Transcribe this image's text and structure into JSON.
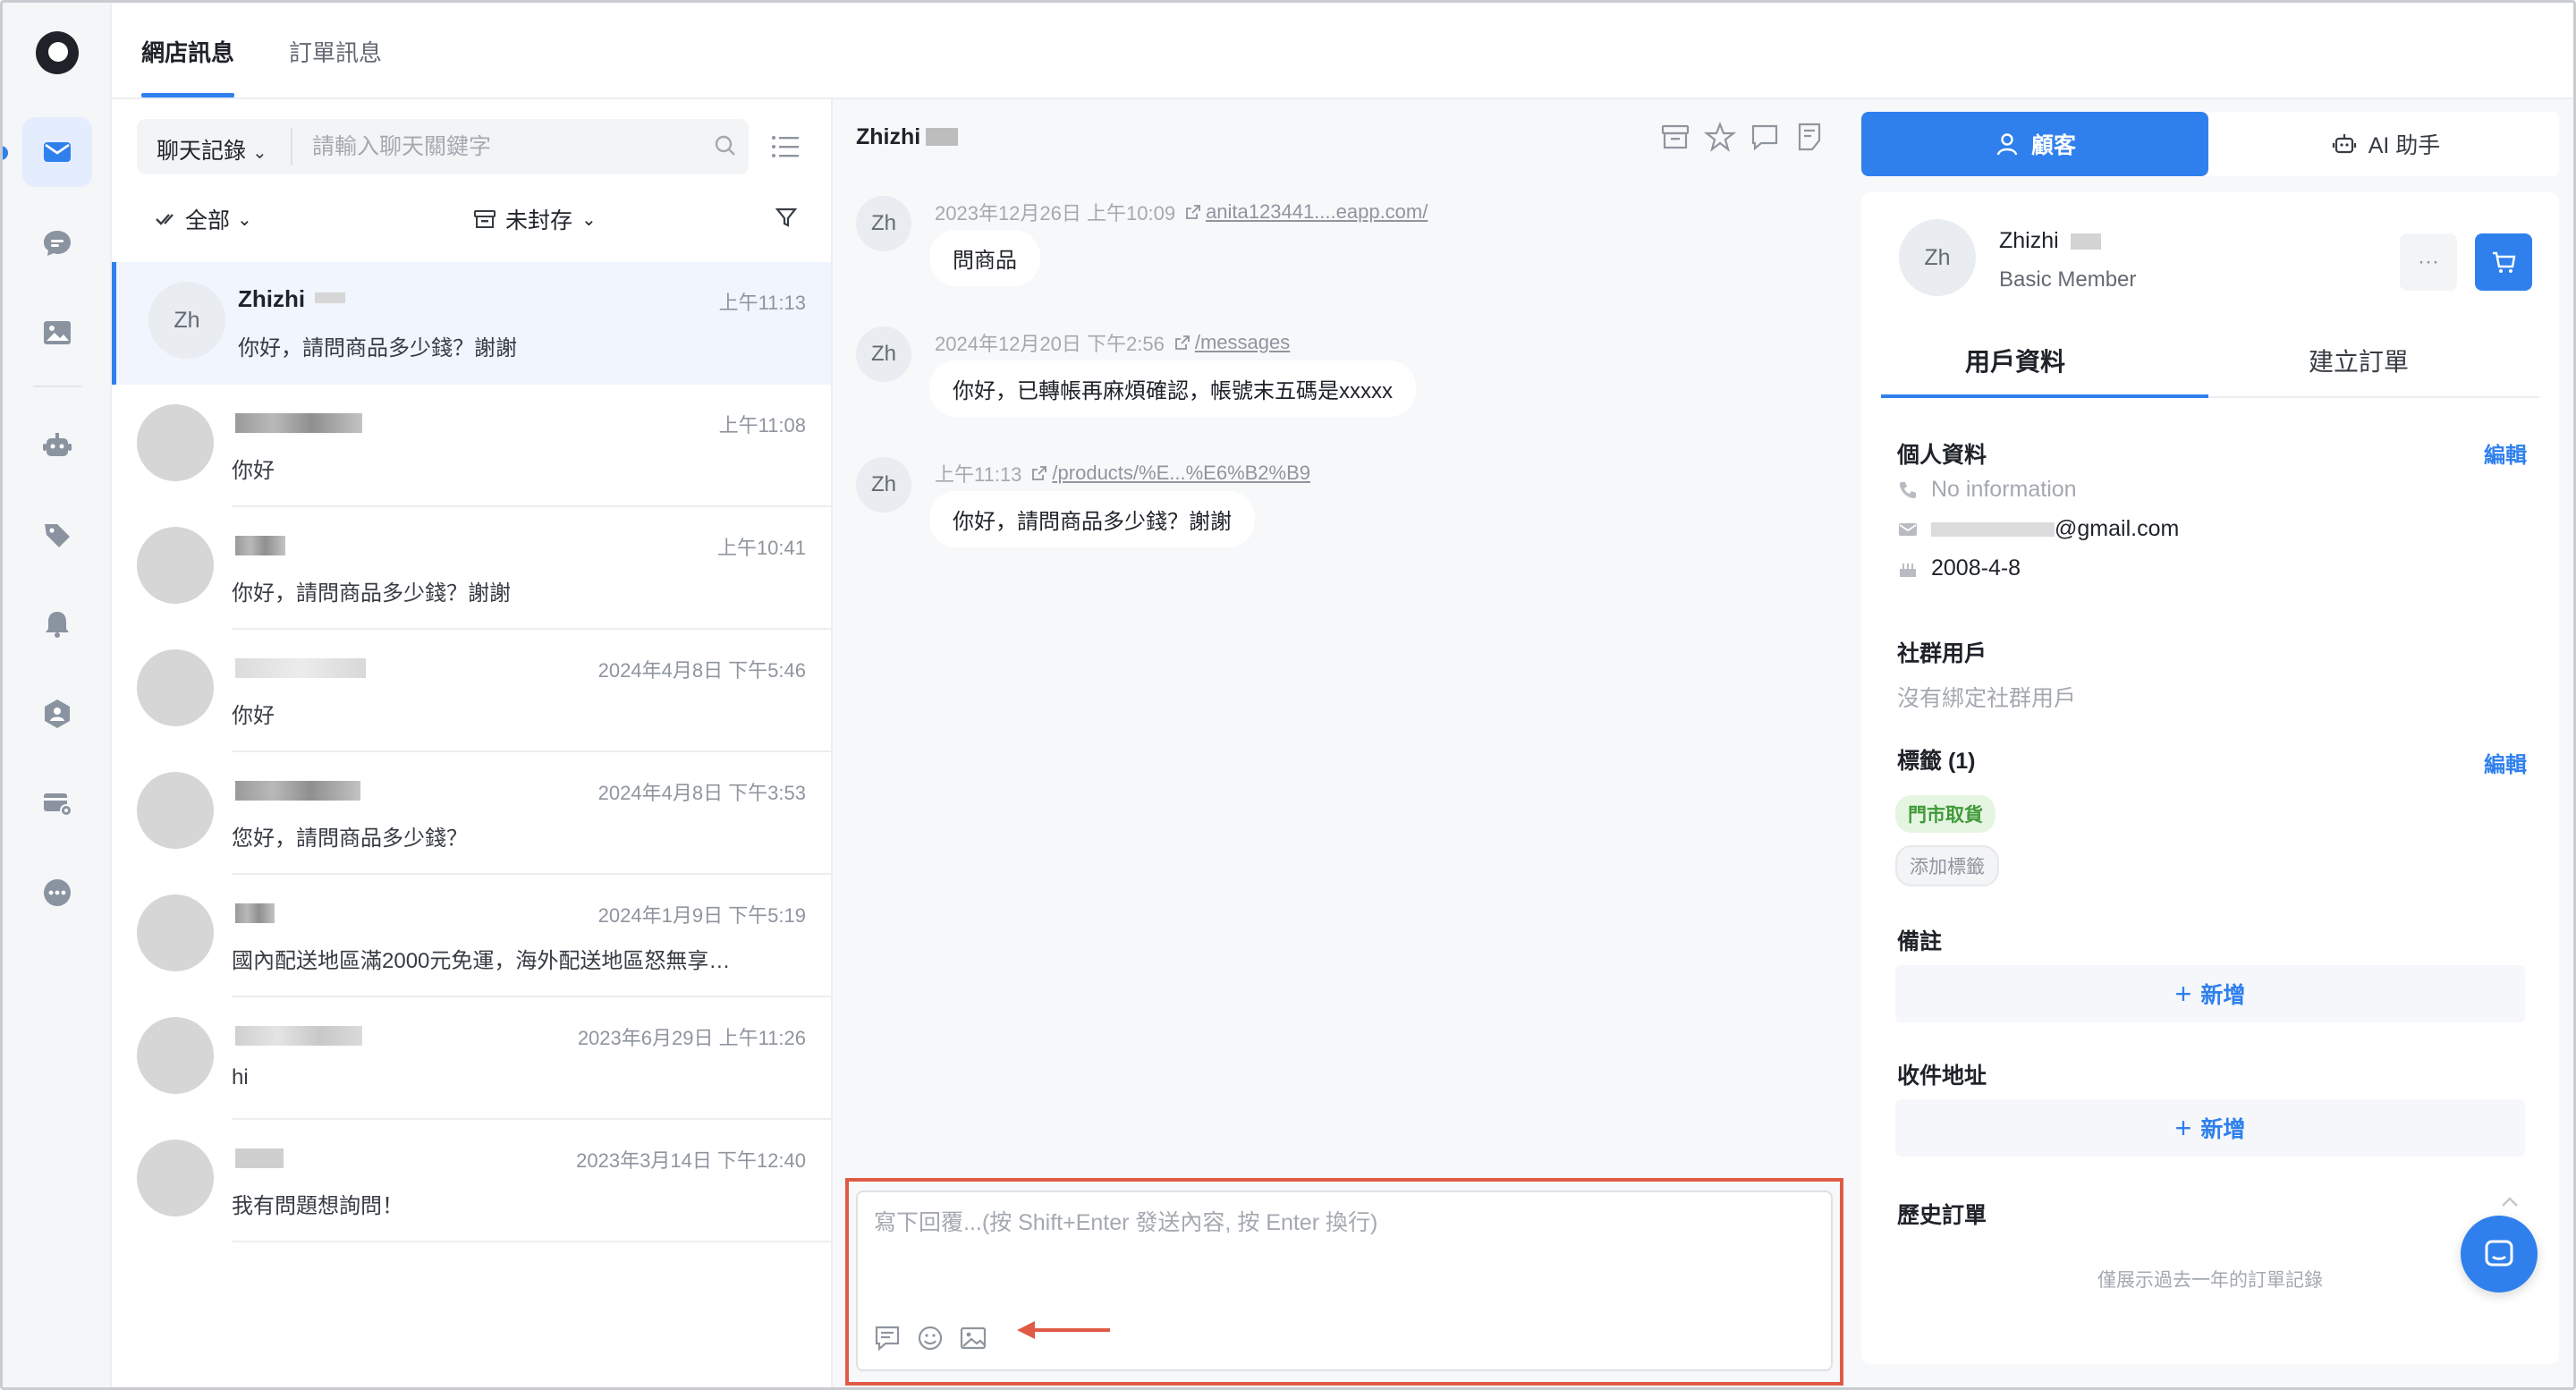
{
  "top_tabs": {
    "shop_messages": "網店訊息",
    "order_messages": "訂單訊息"
  },
  "conversation_list": {
    "search": {
      "scope": "聊天記錄",
      "placeholder": "請輸入聊天關鍵字"
    },
    "filter_all": "全部",
    "filter_archive": "未封存",
    "items": [
      {
        "avatar": "Zh",
        "name": "Zhizhi",
        "time": "上午11:13",
        "message": "你好，請問商品多少錢？謝謝"
      },
      {
        "avatar": "",
        "name": "",
        "time": "上午11:08",
        "message": "你好"
      },
      {
        "avatar": "",
        "name": "",
        "time": "上午10:41",
        "message": "你好，請問商品多少錢？謝謝"
      },
      {
        "avatar": "",
        "name": "",
        "time": "2024年4月8日 下午5:46",
        "message": "你好"
      },
      {
        "avatar": "",
        "name": "",
        "time": "2024年4月8日 下午3:53",
        "message": "您好，請問商品多少錢？"
      },
      {
        "avatar": "",
        "name": "",
        "time": "2024年1月9日 下午5:19",
        "message": "國內配送地區滿2000元免運，海外配送地區怒無享…"
      },
      {
        "avatar": "",
        "name": "",
        "time": "2023年6月29日 上午11:26",
        "message": "hi"
      },
      {
        "avatar": "",
        "name": "",
        "time": "2023年3月14日 下午12:40",
        "message": "我有問題想詢問！"
      }
    ]
  },
  "chat": {
    "title": "Zhizhi",
    "messages": [
      {
        "avatar": "Zh",
        "timestamp": "2023年12月26日 上午10:09",
        "link": "anita123441....eapp.com/",
        "text": "問商品"
      },
      {
        "avatar": "Zh",
        "timestamp": "2024年12月20日 下午2:56",
        "link": "/messages",
        "text": "你好，已轉帳再麻煩確認，帳號末五碼是xxxxx"
      },
      {
        "avatar": "Zh",
        "timestamp": "上午11:13",
        "link": "/products/%E...%E6%B2%B9",
        "text": "你好，請問商品多少錢？謝謝"
      }
    ],
    "composer_placeholder": "寫下回覆...(按 Shift+Enter 發送內容, 按 Enter 換行)"
  },
  "right_panel": {
    "tab_customer": "顧客",
    "tab_ai": "AI 助手",
    "customer": {
      "avatar": "Zh",
      "name": "Zhizhi",
      "level": "Basic Member",
      "more": "···"
    },
    "sub_tabs": {
      "profile": "用戶資料",
      "create_order": "建立訂單"
    },
    "personal": {
      "title": "個人資料",
      "edit": "編輯",
      "phone": "No information",
      "email_suffix": "@gmail.com",
      "birthday": "2008-4-8"
    },
    "social": {
      "title": "社群用戶",
      "empty": "沒有綁定社群用戶"
    },
    "tags": {
      "title": "標籤 (1)",
      "edit": "編輯",
      "items": [
        "門市取貨"
      ],
      "add": "添加標籤"
    },
    "notes": {
      "title": "備註",
      "add": "新增"
    },
    "address": {
      "title": "收件地址",
      "add": "新增"
    },
    "history": {
      "title": "歷史訂單",
      "note": "僅展示過去一年的訂單記錄"
    }
  },
  "colors": {
    "accent": "#2f80ed",
    "highlight_box": "#e05a45",
    "tag_green": "#3f9a3a"
  }
}
